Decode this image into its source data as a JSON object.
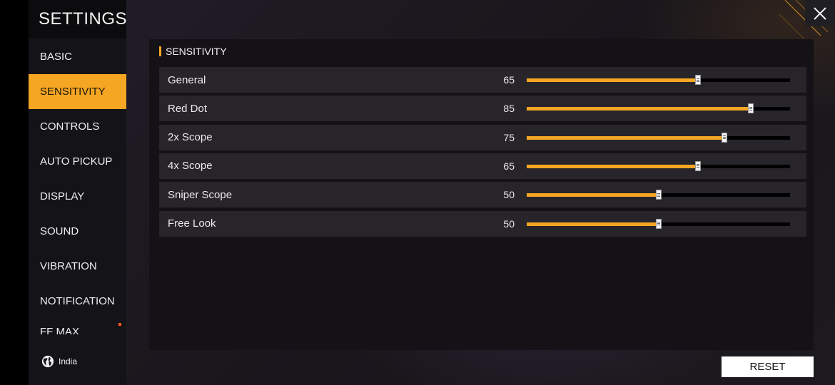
{
  "sidebar": {
    "title": "SETTINGS",
    "items": [
      {
        "label": "BASIC",
        "active": false
      },
      {
        "label": "SENSITIVITY",
        "active": true
      },
      {
        "label": "CONTROLS",
        "active": false
      },
      {
        "label": "AUTO PICKUP",
        "active": false
      },
      {
        "label": "DISPLAY",
        "active": false
      },
      {
        "label": "SOUND",
        "active": false
      },
      {
        "label": "VIBRATION",
        "active": false
      },
      {
        "label": "NOTIFICATION",
        "active": false
      },
      {
        "label": "FF MAX",
        "active": false
      }
    ],
    "region": "India"
  },
  "panel": {
    "header": "SENSITIVITY",
    "rows": [
      {
        "label": "General",
        "value": 65
      },
      {
        "label": "Red Dot",
        "value": 85
      },
      {
        "label": "2x Scope",
        "value": 75
      },
      {
        "label": "4x Scope",
        "value": 65
      },
      {
        "label": "Sniper Scope",
        "value": 50
      },
      {
        "label": "Free Look",
        "value": 50
      }
    ],
    "slider_max": 100
  },
  "buttons": {
    "reset": "RESET"
  },
  "icons": {
    "close": "close-icon",
    "region": "globe-icon"
  },
  "colors": {
    "accent": "#f5a623",
    "panel_bg": "#141216",
    "row_bg": "#27252a"
  }
}
